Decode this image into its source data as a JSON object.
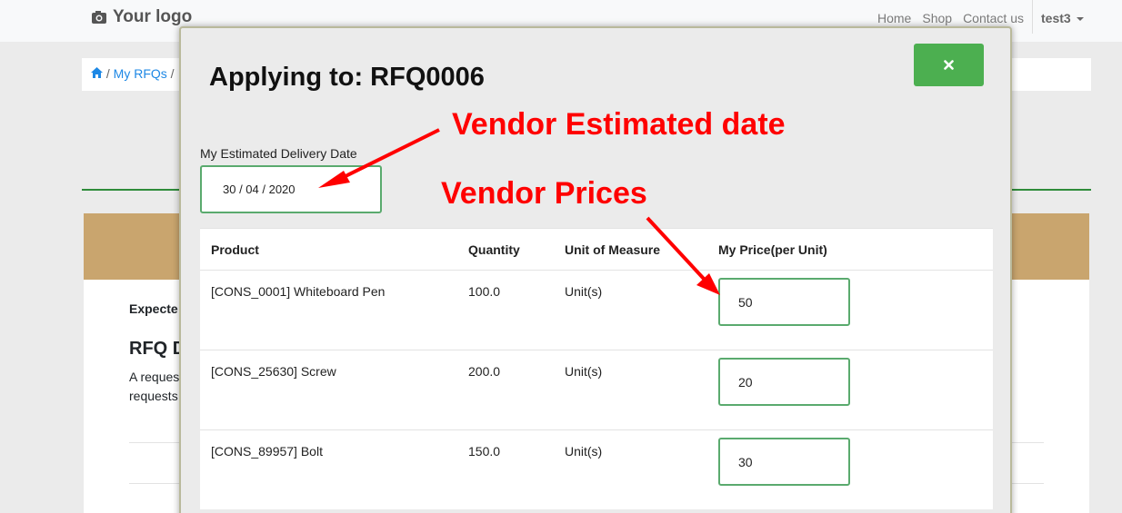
{
  "nav": {
    "logo_text": "Your logo",
    "logo_icon": "camera-icon",
    "links": [
      "Home",
      "Shop",
      "Contact us"
    ],
    "user": "test3"
  },
  "breadcrumb": {
    "home_icon": "home-icon",
    "items": [
      "My RFQs"
    ],
    "separator": "/"
  },
  "background": {
    "expected_label": "Expecte",
    "rfq_heading": "RFQ D",
    "desc_line1": "A reques",
    "desc_line2": "requests"
  },
  "modal": {
    "title": "Applying to: RFQ0006",
    "close_icon": "close-icon",
    "date_label": "My Estimated Delivery Date",
    "date_value": "30 / 04 / 2020",
    "table": {
      "headers": [
        "Product",
        "Quantity",
        "Unit of Measure",
        "My Price(per Unit)"
      ],
      "rows": [
        {
          "product": "[CONS_0001] Whiteboard Pen",
          "quantity": "100.0",
          "uom": "Unit(s)",
          "price": "50"
        },
        {
          "product": "[CONS_25630] Screw",
          "quantity": "200.0",
          "uom": "Unit(s)",
          "price": "20"
        },
        {
          "product": "[CONS_89957] Bolt",
          "quantity": "150.0",
          "uom": "Unit(s)",
          "price": "30"
        }
      ]
    }
  },
  "annotations": {
    "date_note": "Vendor Estimated date",
    "price_note": "Vendor Prices",
    "color": "#ff0000"
  },
  "colors": {
    "accent_green": "#4caf50",
    "link_blue": "#1e88e5",
    "tan": "#c9a56e"
  }
}
